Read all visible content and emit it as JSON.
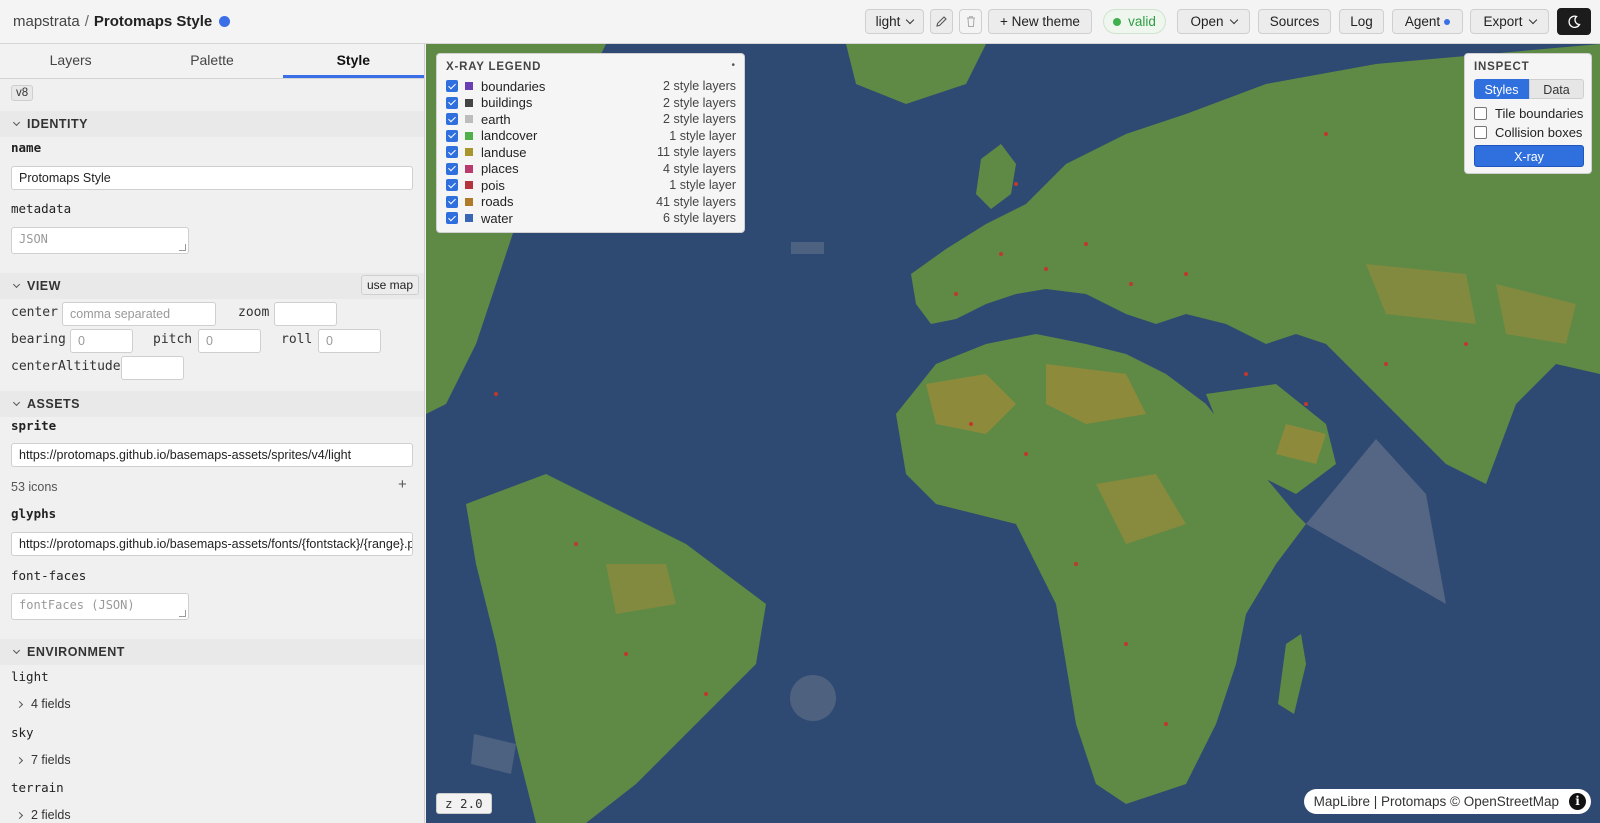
{
  "brand": {
    "app": "mapstrata",
    "separator": "/",
    "project": "Protomaps Style"
  },
  "toolbar": {
    "theme_value": "light",
    "new_theme": "+ New theme",
    "valid": "valid",
    "open": "Open",
    "sources": "Sources",
    "log": "Log",
    "agent": "Agent",
    "export": "Export"
  },
  "tabs": [
    "Layers",
    "Palette",
    "Style"
  ],
  "version": "v8",
  "identity": {
    "title": "IDENTITY",
    "name_label": "name",
    "name_value": "Protomaps Style",
    "metadata_label": "metadata",
    "metadata_placeholder": "JSON"
  },
  "view": {
    "title": "VIEW",
    "use_map": "use map",
    "center_label": "center",
    "center_placeholder": "comma separated",
    "zoom_label": "zoom",
    "bearing_label": "bearing",
    "bearing_value": "0",
    "pitch_label": "pitch",
    "pitch_value": "0",
    "roll_label": "roll",
    "roll_value": "0",
    "center_altitude_label": "centerAltitude"
  },
  "assets": {
    "title": "ASSETS",
    "sprite_label": "sprite",
    "sprite_value": "https://protomaps.github.io/basemaps-assets/sprites/v4/light",
    "icons_count": "53 icons",
    "glyphs_label": "glyphs",
    "glyphs_value": "https://protomaps.github.io/basemaps-assets/fonts/{fontstack}/{range}.pbf",
    "font_faces_label": "font-faces",
    "font_faces_placeholder": "fontFaces (JSON)"
  },
  "environment": {
    "title": "ENVIRONMENT",
    "light_label": "light",
    "light_fields": "4 fields",
    "sky_label": "sky",
    "sky_fields": "7 fields",
    "terrain_label": "terrain",
    "terrain_fields": "2 fields"
  },
  "legend": {
    "title": "X-RAY LEGEND",
    "items": [
      {
        "name": "boundaries",
        "count": "2 style layers",
        "color": "#6a3fb5"
      },
      {
        "name": "buildings",
        "count": "2 style layers",
        "color": "#444444"
      },
      {
        "name": "earth",
        "count": "2 style layers",
        "color": "#bdbdbd"
      },
      {
        "name": "landcover",
        "count": "1 style layer",
        "color": "#4fb04a"
      },
      {
        "name": "landuse",
        "count": "11 style layers",
        "color": "#a7962c"
      },
      {
        "name": "places",
        "count": "4 style layers",
        "color": "#b83a6e"
      },
      {
        "name": "pois",
        "count": "1 style layer",
        "color": "#b5333a"
      },
      {
        "name": "roads",
        "count": "41 style layers",
        "color": "#b07a2b"
      },
      {
        "name": "water",
        "count": "6 style layers",
        "color": "#3a67b5"
      }
    ]
  },
  "inspect": {
    "title": "INSPECT",
    "styles": "Styles",
    "data": "Data",
    "tile_boundaries": "Tile boundaries",
    "collision_boxes": "Collision boxes",
    "xray": "X-ray"
  },
  "map": {
    "zoom_badge": "z 2.0",
    "attribution": "MapLibre | Protomaps © OpenStreetMap",
    "water_color": "#2f4a72",
    "land_color": "#5e8a45",
    "landuse_color": "#9a8a3a"
  }
}
